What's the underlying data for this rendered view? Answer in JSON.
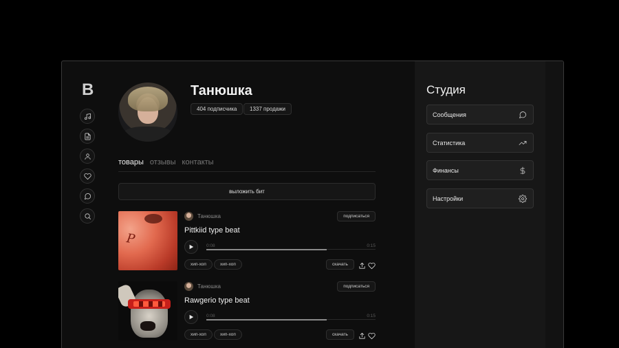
{
  "sidebar": {
    "logo": "B",
    "items": [
      {
        "icon": "music-note-icon"
      },
      {
        "icon": "document-icon"
      },
      {
        "icon": "user-icon"
      },
      {
        "icon": "heart-icon"
      },
      {
        "icon": "chat-icon"
      },
      {
        "icon": "search-icon"
      }
    ]
  },
  "profile": {
    "name": "Танюшка",
    "subscribers": "404 подписчика",
    "sales": "1337 продажи"
  },
  "tabs": [
    {
      "label": "товары",
      "active": true
    },
    {
      "label": "отзывы",
      "active": false
    },
    {
      "label": "контакты",
      "active": false
    }
  ],
  "upload_label": "выложить бит",
  "beats": [
    {
      "author": "Танюшка",
      "follow_label": "подписаться",
      "title": "Pittkiid type beat",
      "time_current": "0:08",
      "time_total": "0:15",
      "progress": 0.71,
      "genres": [
        "хип-хоп",
        "хип-хоп"
      ],
      "download_label": "скачать"
    },
    {
      "author": "Танюшка",
      "follow_label": "подписаться",
      "title": "Rawgerio type beat",
      "time_current": "0:08",
      "time_total": "0:15",
      "progress": 0.71,
      "genres": [
        "хип-хоп",
        "хип-хоп"
      ],
      "download_label": "скачать"
    }
  ],
  "studio": {
    "title": "Студия",
    "items": [
      {
        "label": "Сообщения",
        "icon": "chat-bubble-icon"
      },
      {
        "label": "Статистика",
        "icon": "trending-up-icon"
      },
      {
        "label": "Финансы",
        "icon": "dollar-icon"
      },
      {
        "label": "Настройки",
        "icon": "gear-icon"
      }
    ]
  }
}
